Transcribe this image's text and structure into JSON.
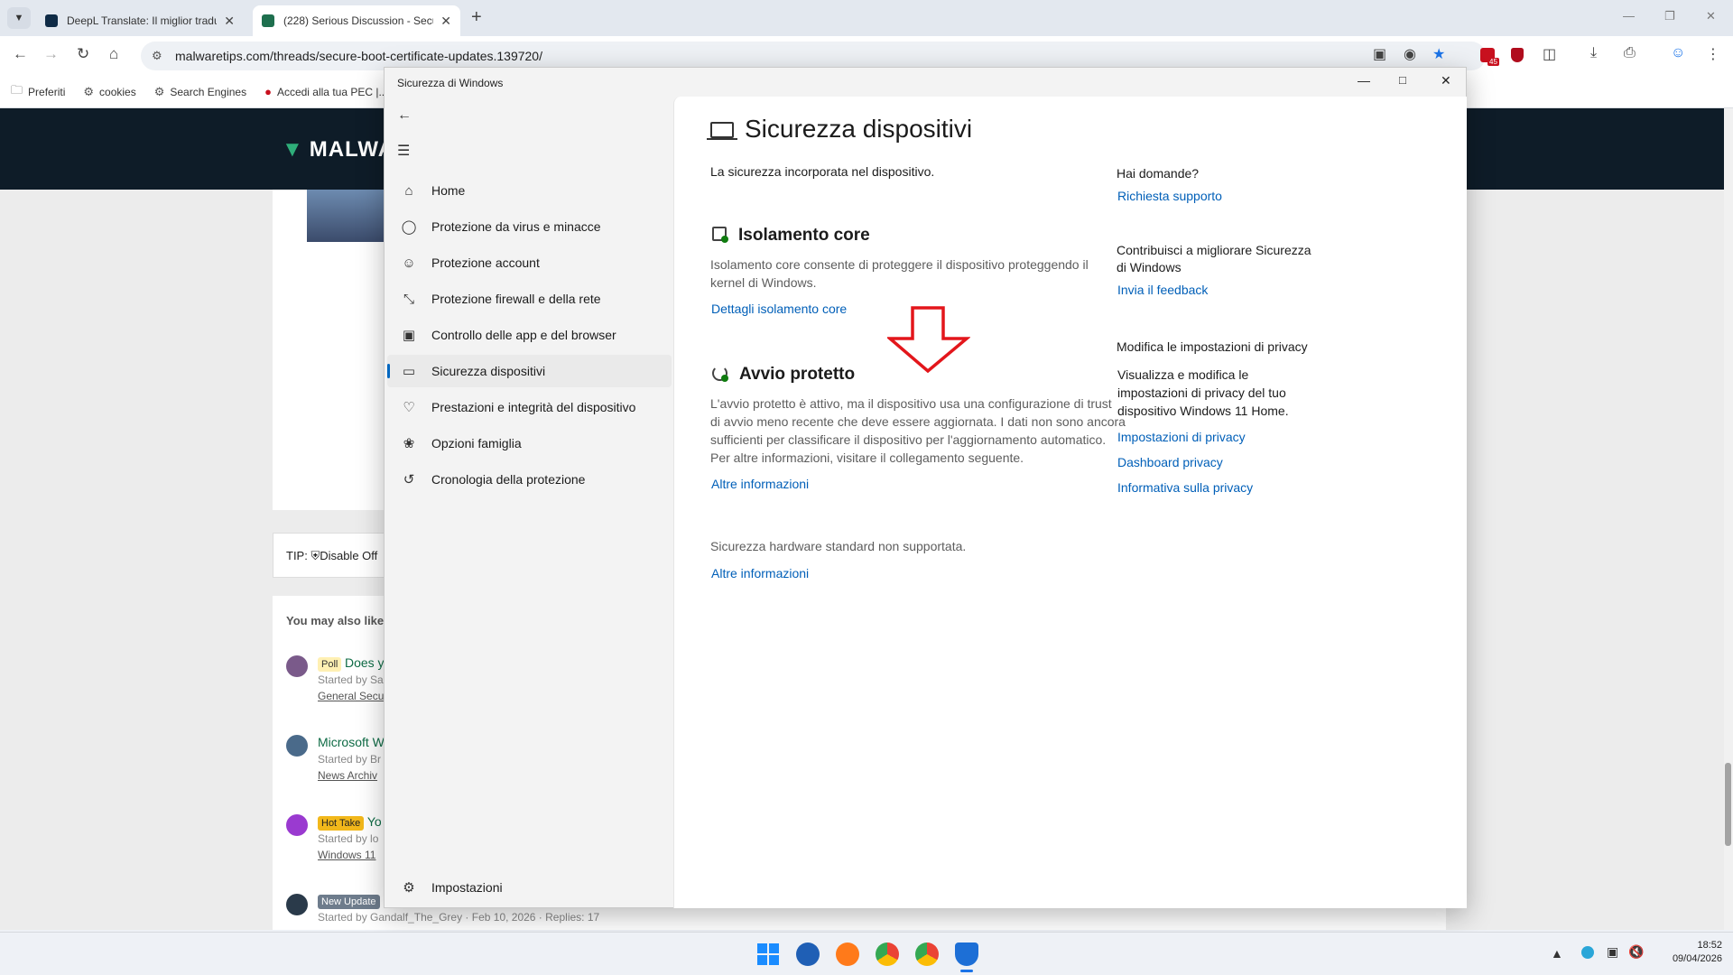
{
  "browser": {
    "tabs": [
      {
        "title": "DeepL Translate: Il miglior tradu",
        "active": false
      },
      {
        "title": "(228) Serious Discussion - Secu",
        "active": true
      }
    ],
    "url": "malwaretips.com/threads/secure-boot-certificate-updates.139720/",
    "bookmarks": [
      "Preferiti",
      "cookies",
      "Search Engines",
      "Accedi alla tua PEC |..."
    ],
    "extension_badge": "45"
  },
  "website": {
    "logo": "MALWA",
    "tip": "TIP: ⛨Disable Off",
    "also_like": "You may also like",
    "items": [
      {
        "badge": "Poll",
        "title": "Does y",
        "meta": "Started by Sa",
        "forum": "General Secu"
      },
      {
        "badge": "",
        "title": "Microsoft W",
        "meta": "Started by Br",
        "forum": "News Archiv"
      },
      {
        "badge": "Hot Take",
        "title": "Yo",
        "meta": "Started by lo",
        "forum": "Windows 11"
      },
      {
        "badge": "New Update",
        "title": "",
        "meta": "Started by Gandalf_The_Grey · Feb 10, 2026 · Replies: 17",
        "forum": ""
      }
    ]
  },
  "window": {
    "title": "Sicurezza di Windows",
    "nav": [
      {
        "label": "Home",
        "icon": "home-icon"
      },
      {
        "label": "Protezione da virus e minacce",
        "icon": "shield-icon"
      },
      {
        "label": "Protezione account",
        "icon": "person-icon"
      },
      {
        "label": "Protezione firewall e della rete",
        "icon": "antenna-icon"
      },
      {
        "label": "Controllo delle app e del browser",
        "icon": "app-window-icon"
      },
      {
        "label": "Sicurezza dispositivi",
        "icon": "laptop-icon",
        "selected": true
      },
      {
        "label": "Prestazioni e integrità del dispositivo",
        "icon": "heart-pulse-icon"
      },
      {
        "label": "Opzioni famiglia",
        "icon": "family-icon"
      },
      {
        "label": "Cronologia della protezione",
        "icon": "history-icon"
      }
    ],
    "settings": "Impostazioni",
    "page_title": "Sicurezza dispositivi",
    "page_subtitle": "La sicurezza incorporata nel dispositivo.",
    "core_isolation": {
      "title": "Isolamento core",
      "lines": [
        "Isolamento core consente di proteggere il dispositivo proteggendo il",
        "kernel di Windows."
      ],
      "link": "Dettagli isolamento core"
    },
    "secure_boot": {
      "title": "Avvio protetto",
      "lines": [
        "L'avvio protetto è attivo, ma il dispositivo usa una configurazione di trust",
        "di avvio meno recente che deve essere aggiornata. I dati non sono ancora",
        "sufficienti per classificare il dispositivo per l'aggiornamento automatico.",
        "Per altre informazioni, visitare il collegamento seguente."
      ],
      "link": "Altre informazioni"
    },
    "hardware": {
      "text": "Sicurezza hardware standard non supportata.",
      "link": "Altre informazioni"
    },
    "right": {
      "questions_title": "Hai domande?",
      "questions_link": "Richiesta supporto",
      "improve_title_1": "Contribuisci a migliorare Sicurezza",
      "improve_title_2": "di Windows",
      "improve_link": "Invia il feedback",
      "privacy_title": "Modifica le impostazioni di privacy",
      "privacy_lines": [
        "Visualizza e modifica le",
        "impostazioni di privacy del tuo",
        "dispositivo Windows 11 Home."
      ],
      "privacy_links": [
        "Impostazioni di privacy",
        "Dashboard privacy",
        "Informativa sulla privacy"
      ]
    },
    "annotation_color": "#e3161b"
  },
  "taskbar": {
    "time": "18:52",
    "date": "09/04/2026"
  }
}
